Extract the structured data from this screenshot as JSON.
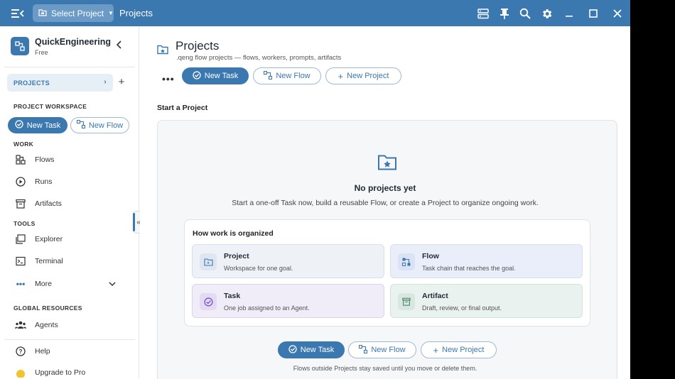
{
  "titlebar": {
    "project_select_label": "Select Project",
    "title": "Projects"
  },
  "sidebar": {
    "brand_name": "QuickEngineering",
    "brand_plan": "Free",
    "projects_label": "PROJECTS",
    "workspace_title": "PROJECT WORKSPACE",
    "new_task_label": "New Task",
    "new_flow_label": "New Flow",
    "work_title": "WORK",
    "work_items": [
      "Flows",
      "Runs",
      "Artifacts"
    ],
    "tools_title": "TOOLS",
    "tools_items": [
      "Explorer",
      "Terminal",
      "More"
    ],
    "global_title": "GLOBAL RESOURCES",
    "global_items": [
      "Agents"
    ],
    "help_label": "Help",
    "upgrade_label": "Upgrade to Pro"
  },
  "main": {
    "title": "Projects",
    "subtitle": ".qeng flow projects — flows, workers, prompts, artifacts",
    "toolbar": {
      "new_task": "New Task",
      "new_flow": "New Flow",
      "new_project": "New Project"
    },
    "start_title": "Start a Project",
    "empty_title": "No projects yet",
    "empty_desc": "Start a one-off Task now, build a reusable Flow, or create a Project to organize ongoing work.",
    "how_title": "How work is organized",
    "tiles": [
      {
        "title": "Project",
        "desc": "Workspace for one goal."
      },
      {
        "title": "Flow",
        "desc": "Task chain that reaches the goal."
      },
      {
        "title": "Task",
        "desc": "One job assigned to an Agent."
      },
      {
        "title": "Artifact",
        "desc": "Draft, review, or final output."
      }
    ],
    "bottom": {
      "new_task": "New Task",
      "new_flow": "New Flow",
      "new_project": "New Project"
    },
    "footer_note": "Flows outside Projects stay saved until you move or delete them."
  },
  "colors": {
    "accent": "#3b78b0",
    "titlebar": "#3b78b0"
  }
}
